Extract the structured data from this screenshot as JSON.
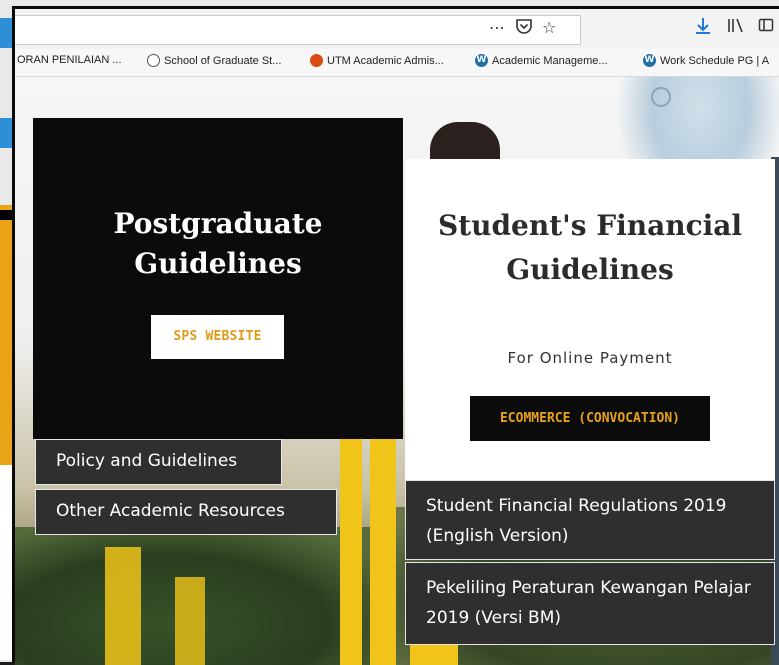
{
  "browser": {
    "toolbar_icons": [
      "more-icon",
      "pocket-icon",
      "bookmark-star-icon",
      "download-icon",
      "library-icon",
      "sidebar-icon"
    ],
    "bookmarks": [
      {
        "label": "ORAN PENILAIAN ...",
        "icon": "none"
      },
      {
        "label": "School of Graduate St...",
        "icon": "globe-icon"
      },
      {
        "label": "UTM Academic Admis...",
        "icon": "utm-icon"
      },
      {
        "label": "Academic Manageme...",
        "icon": "wordpress-icon"
      },
      {
        "label": "Work Schedule PG | A",
        "icon": "wordpress-icon"
      }
    ]
  },
  "page": {
    "postgrad": {
      "title": "Postgraduate Guidelines",
      "button": "SPS WEBSITE"
    },
    "financial": {
      "title": "Student's Financial Guidelines",
      "subtitle": "For Online Payment",
      "button": "ECOMMERCE (CONVOCATION)"
    },
    "links": {
      "policy": "Policy and Guidelines",
      "other": "Other Academic Resources",
      "regulations_en": "Student Financial Regulations 2019 (English Version)",
      "regulations_bm": "Pekeliling Peraturan Kewangan Pelajar 2019 (Versi BM)"
    }
  },
  "colors": {
    "accent_orange": "#e8a317",
    "dark_card": "#0b0b0b",
    "link_box": "#2f2f2f"
  }
}
